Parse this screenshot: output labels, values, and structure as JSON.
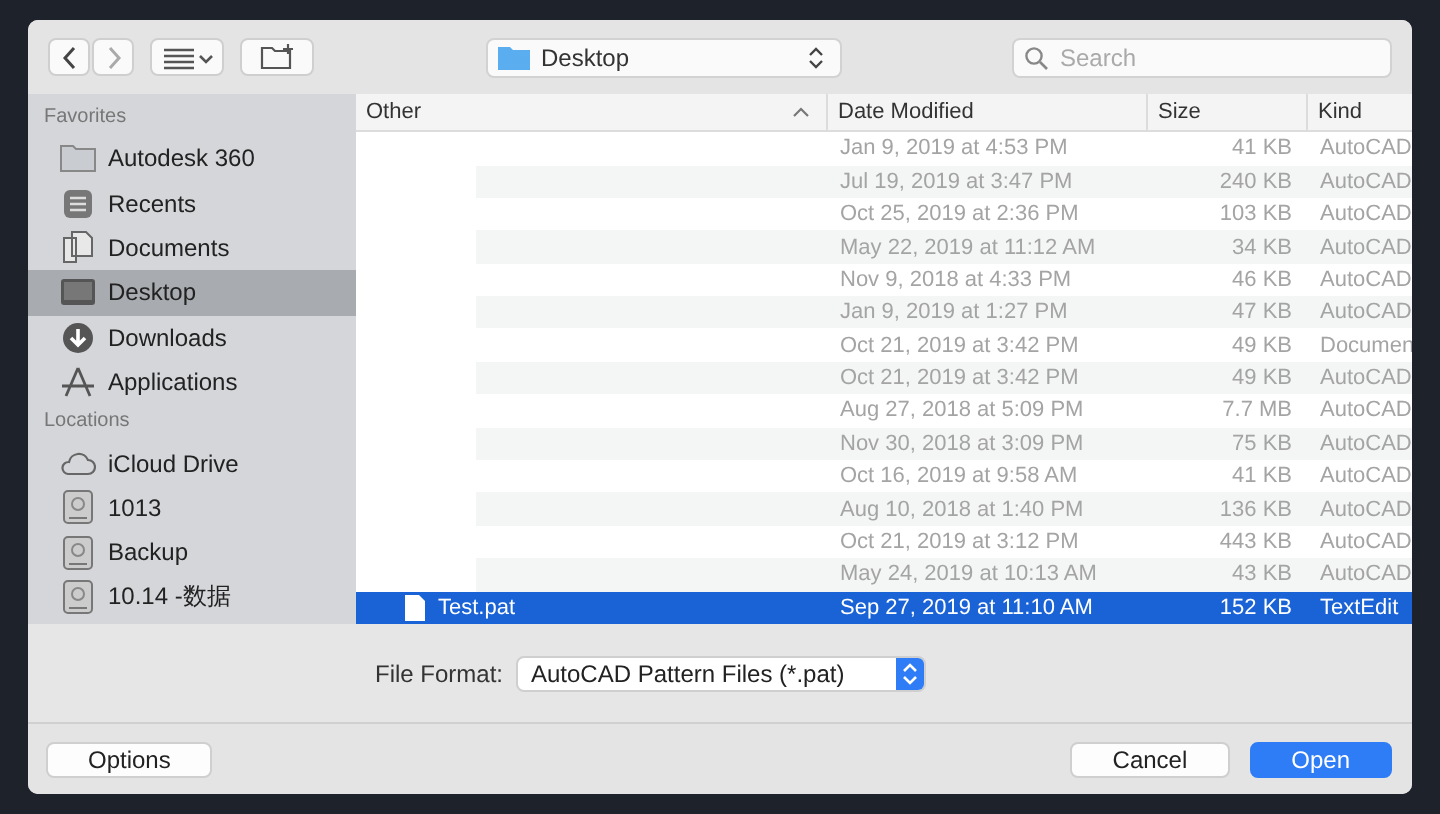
{
  "toolbar": {
    "location": "Desktop",
    "search": {
      "placeholder": "Search"
    }
  },
  "sidebar": {
    "sections": [
      {
        "title": "Favorites",
        "items": [
          {
            "label": "Autodesk 360",
            "selected": false
          },
          {
            "label": "Recents",
            "selected": false
          },
          {
            "label": "Documents",
            "selected": false
          },
          {
            "label": "Desktop",
            "selected": true
          },
          {
            "label": "Downloads",
            "selected": false
          },
          {
            "label": "Applications",
            "selected": false
          }
        ]
      },
      {
        "title": "Locations",
        "items": [
          {
            "label": "iCloud Drive",
            "selected": false
          },
          {
            "label": "1013",
            "selected": false
          },
          {
            "label": "Backup",
            "selected": false
          },
          {
            "label": "10.14 -数据",
            "selected": false
          }
        ]
      }
    ]
  },
  "table": {
    "columns": [
      "Other",
      "Date Modified",
      "Size",
      "Kind"
    ],
    "rows": [
      {
        "date": "Jan 9, 2019 at 4:53 PM",
        "size": "41 KB",
        "kind": "AutoCAD",
        "disabled": true,
        "selected": false
      },
      {
        "date": "Jul 19, 2019 at 3:47 PM",
        "size": "240 KB",
        "kind": "AutoCAD",
        "disabled": true,
        "selected": false
      },
      {
        "date": "Oct 25, 2019 at 2:36 PM",
        "size": "103 KB",
        "kind": "AutoCAD",
        "disabled": true,
        "selected": false
      },
      {
        "date": "May 22, 2019 at 11:12 AM",
        "size": "34 KB",
        "kind": "AutoCAD",
        "disabled": true,
        "selected": false
      },
      {
        "date": "Nov 9, 2018 at 4:33 PM",
        "size": "46 KB",
        "kind": "AutoCAD",
        "disabled": true,
        "selected": false
      },
      {
        "date": "Jan 9, 2019 at 1:27 PM",
        "size": "47 KB",
        "kind": "AutoCAD",
        "disabled": true,
        "selected": false
      },
      {
        "date": "Oct 21, 2019 at 3:42 PM",
        "size": "49 KB",
        "kind": "Documen",
        "disabled": true,
        "selected": false
      },
      {
        "date": "Oct 21, 2019 at 3:42 PM",
        "size": "49 KB",
        "kind": "AutoCAD",
        "disabled": true,
        "selected": false
      },
      {
        "date": "Aug 27, 2018 at 5:09 PM",
        "size": "7.7 MB",
        "kind": "AutoCAD",
        "disabled": true,
        "selected": false
      },
      {
        "date": "Nov 30, 2018 at 3:09 PM",
        "size": "75 KB",
        "kind": "AutoCAD",
        "disabled": true,
        "selected": false
      },
      {
        "date": "Oct 16, 2019 at 9:58 AM",
        "size": "41 KB",
        "kind": "AutoCAD",
        "disabled": true,
        "selected": false
      },
      {
        "date": "Aug 10, 2018 at 1:40 PM",
        "size": "136 KB",
        "kind": "AutoCAD",
        "disabled": true,
        "selected": false
      },
      {
        "date": "Oct 21, 2019 at 3:12 PM",
        "size": "443 KB",
        "kind": "AutoCAD",
        "disabled": true,
        "selected": false
      },
      {
        "date": "May 24, 2019 at 10:13 AM",
        "size": "43 KB",
        "kind": "AutoCAD",
        "disabled": true,
        "selected": false
      },
      {
        "name": "Test.pat",
        "date": "Sep 27, 2019 at 11:10 AM",
        "size": "152 KB",
        "kind": "TextEdit",
        "disabled": false,
        "selected": true
      }
    ]
  },
  "file_format": {
    "label": "File Format:",
    "value": "AutoCAD Pattern Files (*.pat)"
  },
  "footer": {
    "options": "Options",
    "cancel": "Cancel",
    "open": "Open"
  }
}
